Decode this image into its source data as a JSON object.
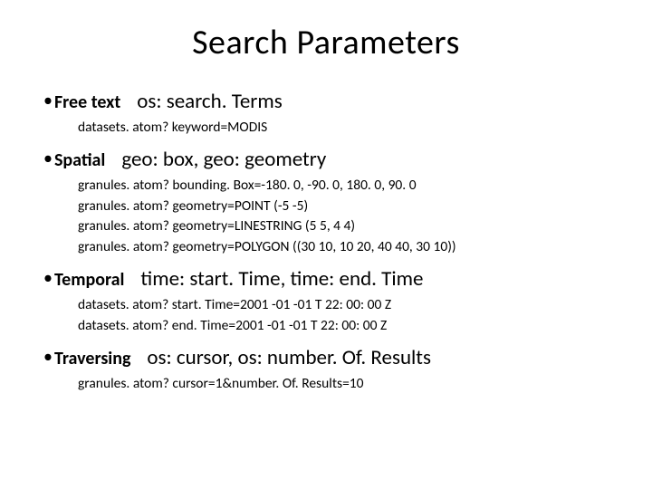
{
  "title": "Search Parameters",
  "sections": [
    {
      "label": "Free text",
      "namespace": "os: search. Terms",
      "examples": [
        "datasets. atom? keyword=MODIS"
      ]
    },
    {
      "label": "Spatial",
      "namespace": "geo: box, geo: geometry",
      "examples": [
        "granules. atom? bounding. Box=-180. 0, -90. 0, 180. 0, 90. 0",
        "granules. atom? geometry=POINT (-5 -5)",
        "granules. atom? geometry=LINESTRING (5 5, 4 4)",
        "granules. atom? geometry=POLYGON ((30 10, 10 20, 40 40, 30 10))"
      ]
    },
    {
      "label": "Temporal",
      "namespace": "time: start. Time, time: end. Time",
      "examples": [
        "datasets. atom? start. Time=2001 -01 -01 T 22: 00: 00 Z",
        "datasets. atom? end. Time=2001 -01 -01 T 22: 00: 00 Z"
      ]
    },
    {
      "label": "Traversing",
      "namespace": "os: cursor, os: number. Of. Results",
      "examples": [
        "granules. atom? cursor=1&number. Of. Results=10"
      ]
    }
  ]
}
